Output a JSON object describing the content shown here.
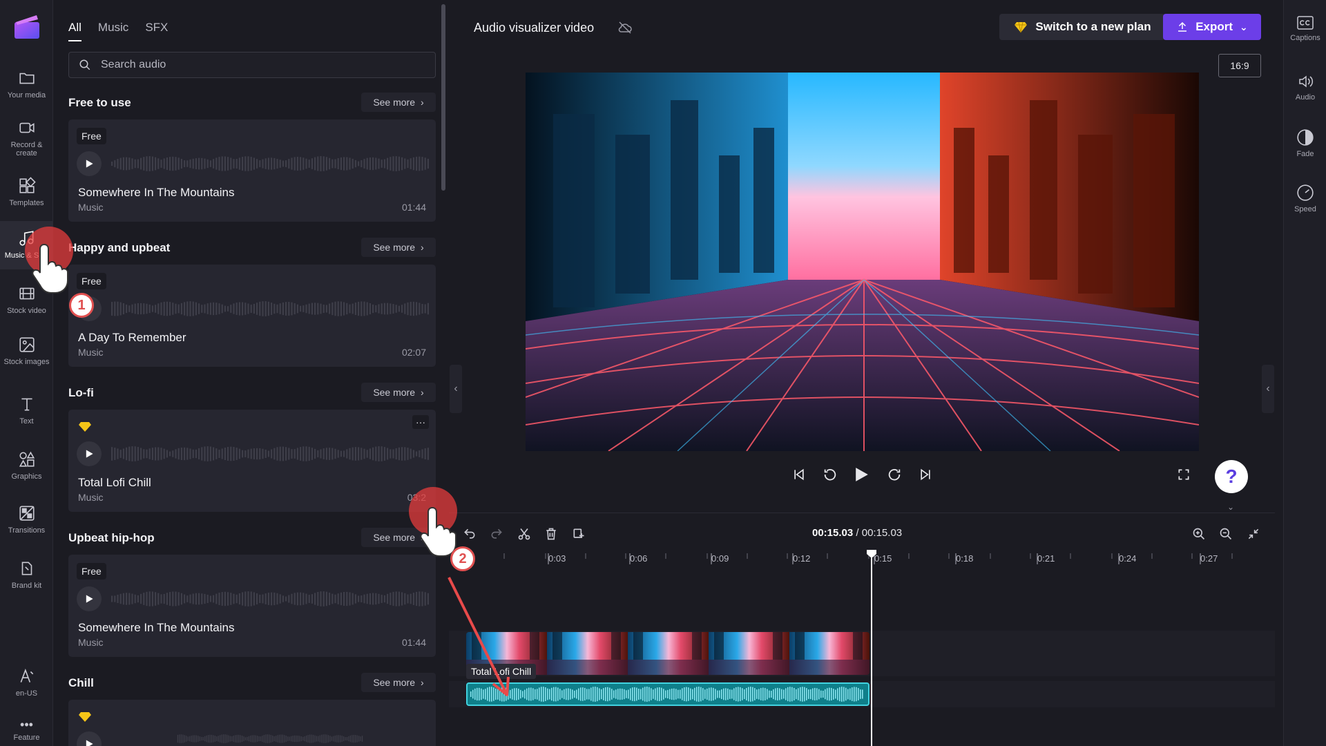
{
  "left_rail": {
    "items": [
      {
        "label": "Your media",
        "icon": "folder-icon"
      },
      {
        "label": "Record & create",
        "icon": "camera-icon"
      },
      {
        "label": "Templates",
        "icon": "templates-icon"
      },
      {
        "label": "Music & SFX",
        "icon": "music-icon"
      },
      {
        "label": "Stock video",
        "icon": "film-icon"
      },
      {
        "label": "Stock images",
        "icon": "image-icon"
      },
      {
        "label": "Text",
        "icon": "text-icon"
      },
      {
        "label": "Graphics",
        "icon": "shapes-icon"
      },
      {
        "label": "Transitions",
        "icon": "transitions-icon"
      },
      {
        "label": "Brand kit",
        "icon": "brand-icon"
      }
    ],
    "language": "en-US",
    "feature": "Feature"
  },
  "audio_panel": {
    "tabs": [
      "All",
      "Music",
      "SFX"
    ],
    "search_placeholder": "Search audio",
    "see_more": "See more",
    "sections": [
      {
        "title": "Free to use",
        "track": {
          "badge": "Free",
          "title": "Somewhere In The Mountains",
          "genre": "Music",
          "duration": "01:44"
        }
      },
      {
        "title": "Happy and upbeat",
        "track": {
          "badge": "Free",
          "title": "A Day To Remember",
          "genre": "Music",
          "duration": "02:07"
        }
      },
      {
        "title": "Lo-fi",
        "track": {
          "badge": "premium",
          "title": "Total Lofi Chill",
          "genre": "Music",
          "duration": "03:2"
        }
      },
      {
        "title": "Upbeat hip-hop",
        "track": {
          "badge": "Free",
          "title": "Somewhere In The Mountains",
          "genre": "Music",
          "duration": "01:44"
        }
      },
      {
        "title": "Chill",
        "track": {
          "badge": "premium",
          "title": "",
          "genre": "",
          "duration": ""
        }
      }
    ]
  },
  "header": {
    "project_title": "Audio visualizer video",
    "plan_button": "Switch to a new plan",
    "export_button": "Export",
    "aspect_ratio": "16:9"
  },
  "right_rail": {
    "items": [
      {
        "label": "Captions",
        "icon": "captions-icon"
      },
      {
        "label": "Audio",
        "icon": "speaker-icon"
      },
      {
        "label": "Fade",
        "icon": "fade-icon"
      },
      {
        "label": "Speed",
        "icon": "speed-icon"
      }
    ]
  },
  "timeline": {
    "current_time": "00:15.03",
    "separator": " / ",
    "total_time": "00:15.03",
    "ticks": [
      "0:03",
      "0:06",
      "0:09",
      "0:12",
      "0:15",
      "0:18",
      "0:21",
      "0:24",
      "0:27"
    ],
    "audio_clip_label": "Total Lofi Chill"
  },
  "annotations": {
    "step1": "1",
    "step2": "2"
  },
  "colors": {
    "accent": "#6c3ee8",
    "audio_clip": "#0f7f8a",
    "audio_border": "#41d3e0",
    "premium": "#f5c518"
  }
}
